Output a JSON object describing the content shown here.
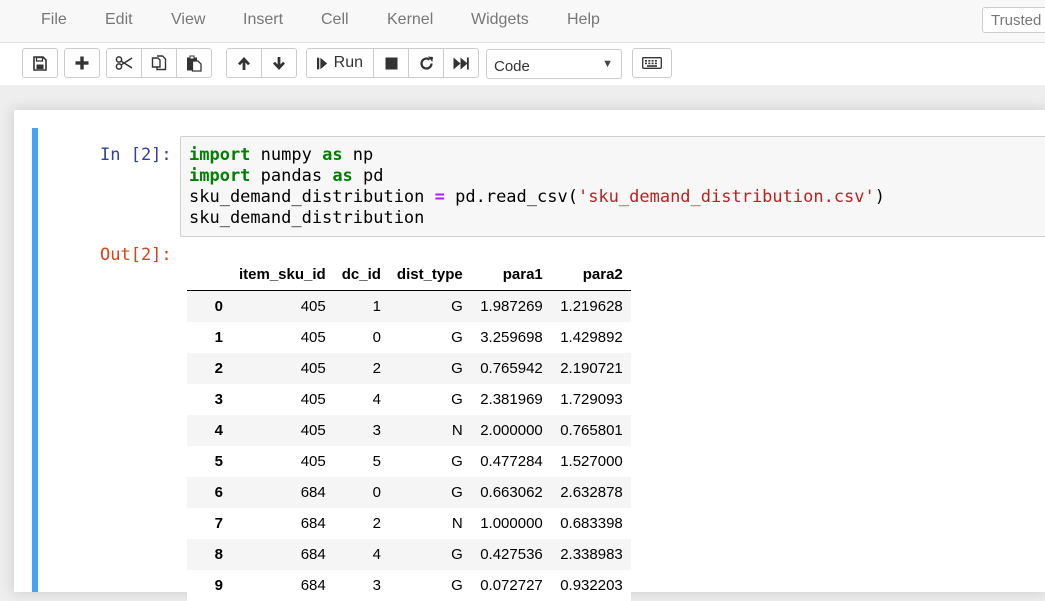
{
  "menubar": {
    "items": [
      "File",
      "Edit",
      "View",
      "Insert",
      "Cell",
      "Kernel",
      "Widgets",
      "Help"
    ],
    "trusted": "Trusted"
  },
  "toolbar": {
    "run_label": "Run",
    "cell_type": "Code",
    "icons": [
      "save-icon",
      "plus-icon",
      "scissors-icon",
      "copy-icon",
      "paste-icon",
      "arrow-up-icon",
      "arrow-down-icon",
      "step-forward-icon",
      "stop-icon",
      "refresh-icon",
      "fast-forward-icon",
      "keyboard-icon"
    ]
  },
  "cell": {
    "in_prompt": "In [2]:",
    "out_prompt": "Out[2]:",
    "code": {
      "line1": {
        "kw1": "import",
        "mod": " numpy ",
        "kw2": "as",
        "alias": " np"
      },
      "line2": {
        "kw1": "import",
        "mod": " pandas ",
        "kw2": "as",
        "alias": " pd"
      },
      "line3": {
        "var": "sku_demand_distribution ",
        "op": "=",
        "call": " pd.read_csv(",
        "str": "'sku_demand_distribution.csv'",
        "close": ")"
      },
      "line4": "sku_demand_distribution"
    }
  },
  "dataframe": {
    "columns": [
      "",
      "item_sku_id",
      "dc_id",
      "dist_type",
      "para1",
      "para2"
    ],
    "rows": [
      [
        "0",
        "405",
        "1",
        "G",
        "1.987269",
        "1.219628"
      ],
      [
        "1",
        "405",
        "0",
        "G",
        "3.259698",
        "1.429892"
      ],
      [
        "2",
        "405",
        "2",
        "G",
        "0.765942",
        "2.190721"
      ],
      [
        "3",
        "405",
        "4",
        "G",
        "2.381969",
        "1.729093"
      ],
      [
        "4",
        "405",
        "3",
        "N",
        "2.000000",
        "0.765801"
      ],
      [
        "5",
        "405",
        "5",
        "G",
        "0.477284",
        "1.527000"
      ],
      [
        "6",
        "684",
        "0",
        "G",
        "0.663062",
        "2.632878"
      ],
      [
        "7",
        "684",
        "2",
        "N",
        "1.000000",
        "0.683398"
      ],
      [
        "8",
        "684",
        "4",
        "G",
        "0.427536",
        "2.338983"
      ],
      [
        "9",
        "684",
        "3",
        "G",
        "0.072727",
        "0.932203"
      ]
    ]
  }
}
